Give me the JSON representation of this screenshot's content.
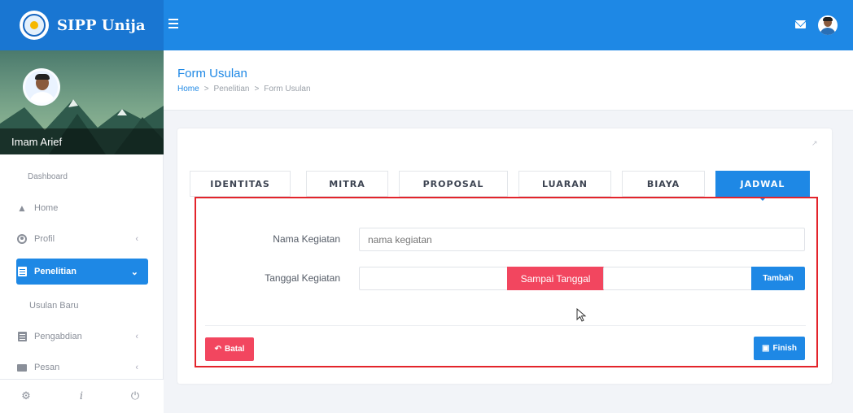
{
  "app": {
    "brand": "SIPP Unija"
  },
  "user": {
    "name": "Imam Arief"
  },
  "sidebar": {
    "section_label": "Dashboard",
    "items": [
      {
        "label": "Home",
        "icon": "home-icon"
      },
      {
        "label": "Profil",
        "icon": "user-icon"
      },
      {
        "label": "Penelitian",
        "icon": "document-icon",
        "active": true
      },
      {
        "label": "Pengabdian",
        "icon": "document-icon"
      },
      {
        "label": "Pesan",
        "icon": "mail-icon"
      }
    ],
    "sub_items": [
      {
        "label": "Usulan Baru"
      }
    ]
  },
  "page": {
    "title": "Form Usulan",
    "breadcrumb": [
      "Home",
      "Penelitian",
      "Form Usulan"
    ]
  },
  "tabs": [
    {
      "label": "IDENTITAS"
    },
    {
      "label": "MITRA"
    },
    {
      "label": "PROPOSAL"
    },
    {
      "label": "LUARAN"
    },
    {
      "label": "BIAYA"
    },
    {
      "label": "JADWAL",
      "active": true
    }
  ],
  "form": {
    "nama_kegiatan_label": "Nama Kegiatan",
    "nama_kegiatan_placeholder": "nama kegiatan",
    "tanggal_kegiatan_label": "Tanggal Kegiatan",
    "range_separator": "Sampai Tanggal",
    "add_button": "Tambah",
    "cancel_button": "Batal",
    "finish_button": "Finish"
  },
  "colors": {
    "primary": "#1e88e5",
    "danger": "#f2465f",
    "highlight_frame": "#e3242b"
  }
}
